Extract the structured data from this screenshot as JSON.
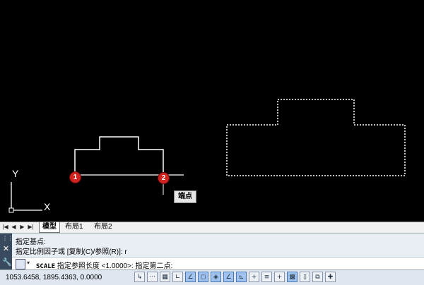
{
  "canvas": {
    "tooltip": "端点",
    "markers": [
      "1",
      "2"
    ],
    "ucs": {
      "y_label": "Y",
      "x_label": "X"
    }
  },
  "tabs": {
    "model": "模型",
    "layout1": "布局1",
    "layout2": "布局2"
  },
  "command": {
    "history": [
      "指定基点:",
      "指定比例因子或 [复制(C)/参照(R)]: r"
    ],
    "prompt_cmd": "SCALE",
    "prompt_text": "指定参照长度 <1.0000>:  指定第二点:"
  },
  "status": {
    "coords": "1053.6458, 1895.4363, 0.0000"
  }
}
